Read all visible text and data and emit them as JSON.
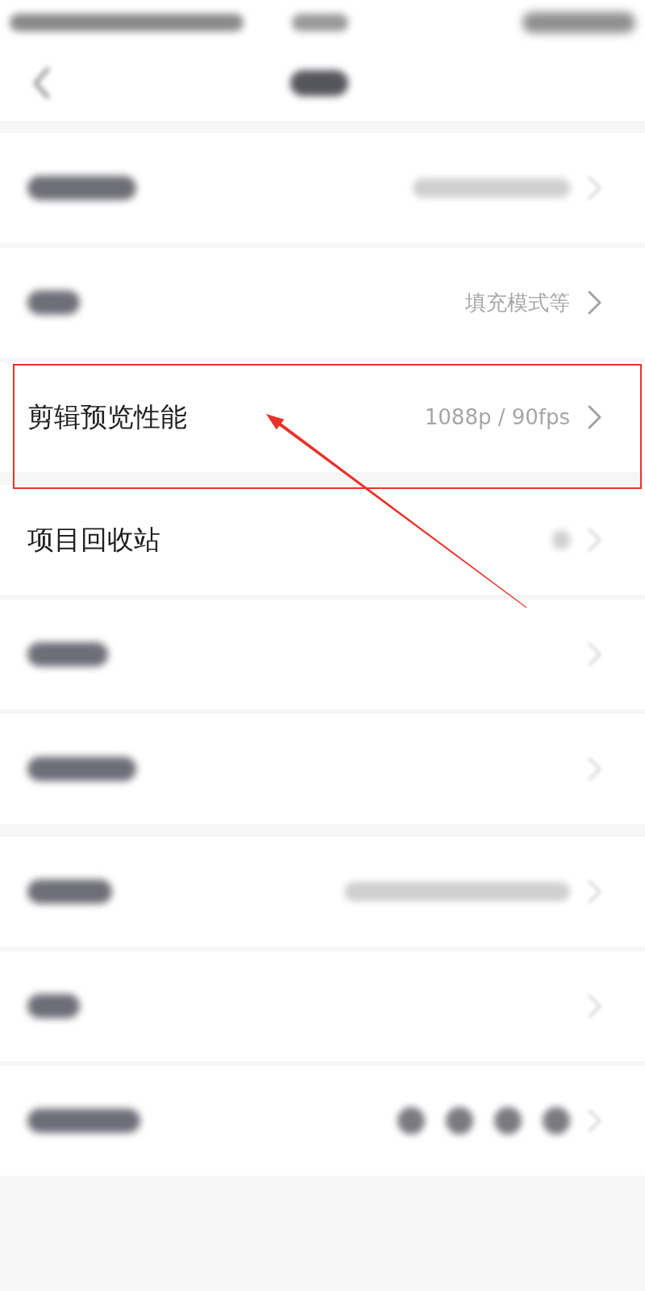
{
  "settings_groups": [
    {
      "rows": [
        {
          "detail": {
            "kind": "blurred"
          },
          "highlighted": false
        },
        {
          "detail": {
            "kind": "text",
            "text": "填充模式等"
          },
          "highlighted": false
        },
        {
          "label": "剪辑预览性能",
          "detail": {
            "kind": "text",
            "text": "1088p / 90fps"
          },
          "highlighted": true
        }
      ]
    },
    {
      "rows": [
        {
          "label": "项目回收站",
          "detail": {
            "kind": "blurred"
          },
          "highlighted": false
        },
        {
          "highlighted": false
        },
        {
          "highlighted": false
        }
      ]
    },
    {
      "rows": [
        {
          "detail": {
            "kind": "blurred"
          },
          "highlighted": false
        },
        {
          "highlighted": false
        },
        {
          "detail": {
            "kind": "icons"
          },
          "highlighted": false
        }
      ]
    }
  ]
}
